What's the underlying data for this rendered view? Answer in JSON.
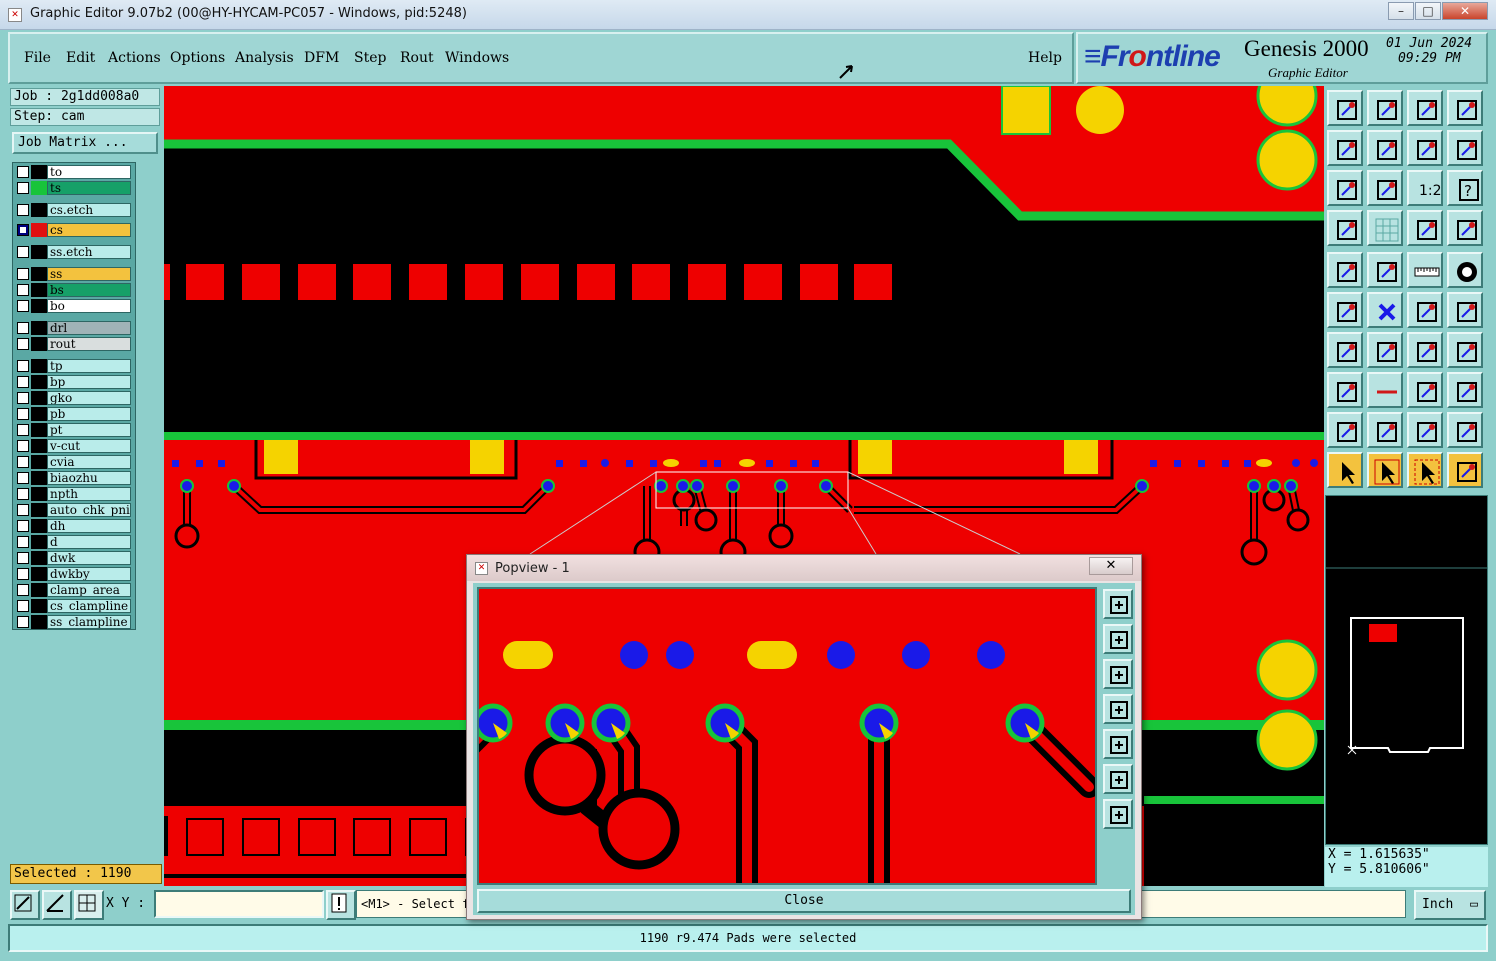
{
  "window": {
    "title": "Graphic Editor 9.07b2 (00@HY-HYCAM-PC057 - Windows, pid:5248)",
    "minimize": "–",
    "maximize": "□",
    "close": "✕"
  },
  "menu": {
    "items": [
      "File",
      "Edit",
      "Actions",
      "Options",
      "Analysis",
      "DFM",
      "Step",
      "Rout",
      "Windows"
    ],
    "help": "Help"
  },
  "brand": {
    "logo_a": "≡Fr",
    "logo_b": "o",
    "logo_c": "ntline",
    "product": "Genesis 2000",
    "subtitle": "Graphic Editor",
    "date": "01 Jun 2024",
    "time": "09:29 PM"
  },
  "panel": {
    "job": "Job : 2g1dd008a0",
    "step": "Step: cam",
    "job_matrix": "Job Matrix ...",
    "selected": "Selected : 1190"
  },
  "layers": [
    {
      "name": "to",
      "color": "#ffffff",
      "marker": "#000000",
      "checked": false
    },
    {
      "name": "ts",
      "color": "#16a068",
      "marker": "#18c43a",
      "checked": false
    },
    {
      "name": "cs.etch",
      "color": "#b9ecea",
      "marker": "#000000",
      "checked": false
    },
    {
      "name": "cs",
      "color": "#f3c23e",
      "marker": "#e01010",
      "checked": true
    },
    {
      "name": "ss.etch",
      "color": "#b9ecea",
      "marker": "#000000",
      "checked": false
    },
    {
      "name": "ss",
      "color": "#f3c23e",
      "marker": "#000000",
      "checked": false
    },
    {
      "name": "bs",
      "color": "#16a068",
      "marker": "#000000",
      "checked": false
    },
    {
      "name": "bo",
      "color": "#ffffff",
      "marker": "#000000",
      "checked": false
    },
    {
      "name": "drl",
      "color": "#9fb3b7",
      "marker": "#000000",
      "checked": false
    },
    {
      "name": "rout",
      "color": "#d9dede",
      "marker": "#000000",
      "checked": false
    },
    {
      "name": "tp",
      "color": "#b9ecea",
      "marker": "#000000",
      "checked": false
    },
    {
      "name": "bp",
      "color": "#b9ecea",
      "marker": "#000000",
      "checked": false
    },
    {
      "name": "gko",
      "color": "#b9ecea",
      "marker": "#000000",
      "checked": false
    },
    {
      "name": "pb",
      "color": "#b9ecea",
      "marker": "#000000",
      "checked": false
    },
    {
      "name": "pt",
      "color": "#b9ecea",
      "marker": "#000000",
      "checked": false
    },
    {
      "name": "v-cut",
      "color": "#b9ecea",
      "marker": "#000000",
      "checked": false
    },
    {
      "name": "cvia",
      "color": "#b9ecea",
      "marker": "#000000",
      "checked": false
    },
    {
      "name": "biaozhu",
      "color": "#b9ecea",
      "marker": "#000000",
      "checked": false
    },
    {
      "name": "npth",
      "color": "#b9ecea",
      "marker": "#000000",
      "checked": false
    },
    {
      "name": "auto_chk_pni",
      "color": "#b9ecea",
      "marker": "#000000",
      "checked": false
    },
    {
      "name": "dh",
      "color": "#b9ecea",
      "marker": "#000000",
      "checked": false
    },
    {
      "name": "d",
      "color": "#b9ecea",
      "marker": "#000000",
      "checked": false
    },
    {
      "name": "dwk",
      "color": "#b9ecea",
      "marker": "#000000",
      "checked": false
    },
    {
      "name": "dwkby",
      "color": "#b9ecea",
      "marker": "#000000",
      "checked": false
    },
    {
      "name": "clamp_area",
      "color": "#b9ecea",
      "marker": "#000000",
      "checked": false
    },
    {
      "name": "cs_clampline",
      "color": "#b9ecea",
      "marker": "#000000",
      "checked": false
    },
    {
      "name": "ss_clampline",
      "color": "#b9ecea",
      "marker": "#000000",
      "checked": false
    }
  ],
  "coords": {
    "x": "X = 1.615635\"",
    "y": "Y = 5.810606\""
  },
  "bottom": {
    "xy_label": "X Y :",
    "xy_value": "",
    "prompt": "<M1> - Select f",
    "unit": "Inch",
    "status": "1190 r9.474 Pads were selected"
  },
  "popview": {
    "title": "Popview - 1",
    "close_x": "✕",
    "close_button": "Close"
  },
  "colors": {
    "copper": "#ee0000",
    "trace_edge": "#18c43a",
    "pad_yellow": "#f5d300",
    "via_blue": "#1a1ae8",
    "background": "#000000"
  }
}
